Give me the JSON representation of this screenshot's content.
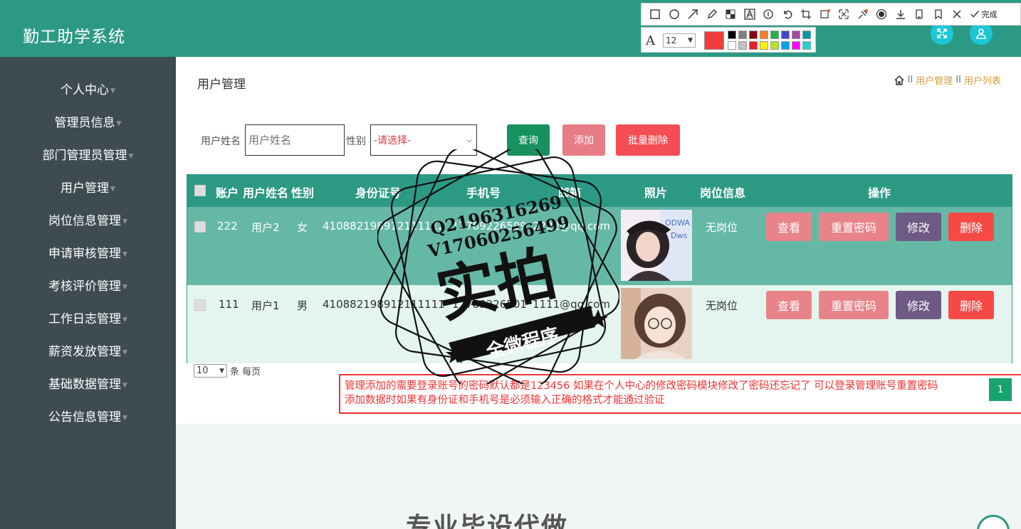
{
  "app": {
    "title": "勤工助学系统"
  },
  "snip_tool": {
    "tools": [
      "rectangle-icon",
      "ellipse-icon",
      "arrow-icon",
      "pencil-icon",
      "mosaic-icon",
      "text-icon",
      "number-icon",
      "undo-icon",
      "crop-icon",
      "ocr-icon",
      "translate-icon",
      "pin-icon",
      "record-icon",
      "download-icon",
      "save-icon",
      "bookmark-icon",
      "close-icon"
    ],
    "done_label": "完成",
    "font_size": "12",
    "current_color": "#f03c3c",
    "palette": [
      "#000000",
      "#7f7f7f",
      "#880015",
      "#ff7f27",
      "#22b14c",
      "#3f48cc",
      "#a349a4",
      "#0099a8",
      "#ffffff",
      "#c3c3c3",
      "#ed1c24",
      "#fff200",
      "#b5e61d",
      "#00a2e8",
      "#ff00ff",
      "#23d3d3"
    ]
  },
  "sidebar": {
    "items": [
      {
        "label": "个人中心"
      },
      {
        "label": "管理员信息"
      },
      {
        "label": "部门管理员管理"
      },
      {
        "label": "用户管理"
      },
      {
        "label": "岗位信息管理"
      },
      {
        "label": "申请审核管理"
      },
      {
        "label": "考核评价管理"
      },
      {
        "label": "工作日志管理"
      },
      {
        "label": "薪资发放管理"
      },
      {
        "label": "基础数据管理"
      },
      {
        "label": "公告信息管理"
      }
    ]
  },
  "page": {
    "title": "用户管理",
    "breadcrumb": [
      "用户管理",
      "用户列表"
    ],
    "breadcrumb_sep": "II"
  },
  "search": {
    "name_label": "用户姓名",
    "name_placeholder": "用户姓名",
    "gender_label": "性别",
    "gender_selected": "-请选择-",
    "query_label": "查询",
    "add_label": "添加",
    "batch_delete_label": "批量删除"
  },
  "table": {
    "columns": [
      "账户",
      "用户姓名",
      "性别",
      "身份证号",
      "手机号",
      "邮箱",
      "照片",
      "岗位信息",
      "操作"
    ],
    "rows": [
      {
        "account": "222",
        "name": "用户2",
        "gender": "女",
        "id_no": "410882198912111112",
        "phone": "17789226599",
        "email": "2222@qq.com",
        "job": "无岗位"
      },
      {
        "account": "111",
        "name": "用户1",
        "gender": "男",
        "id_no": "410882198912111111",
        "phone": "17789226501",
        "email": "1111@qq.com",
        "job": "无岗位"
      }
    ],
    "actions": {
      "view": "查看",
      "reset": "重置密码",
      "edit": "修改",
      "delete": "删除"
    }
  },
  "pager": {
    "page_size": "10",
    "suffix": "条 每页",
    "current_page": "1"
  },
  "note": {
    "line1": "管理添加的需要登录账号的密码默认都是123456 如果在个人中心的修改密码模块修改了密码还忘记了 可以登录管理账号重置密码",
    "line2": "添加数据时如果有身份证和手机号是必须输入正确的格式才能通过验证"
  },
  "watermark": {
    "line1": "Q2196316269",
    "line2": "V17060256499",
    "big": "实拍",
    "ribbon": "全微程序"
  },
  "bottom_text": "专业毕设代做"
}
